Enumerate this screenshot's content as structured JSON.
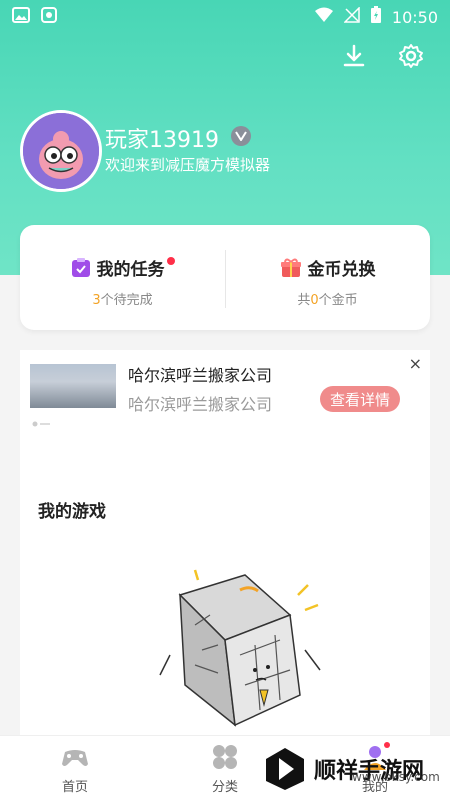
{
  "status_bar": {
    "time": "10:50"
  },
  "header": {
    "download_icon": "download-icon",
    "settings_icon": "gear-icon"
  },
  "profile": {
    "username": "玩家13919",
    "welcome": "欢迎来到减压魔方模拟器"
  },
  "tasks": {
    "title": "我的任务",
    "pending_count": "3",
    "pending_suffix": "个待完成"
  },
  "coins": {
    "title": "金币兑换",
    "prefix": "共",
    "count": "0",
    "suffix": "个金币"
  },
  "ad": {
    "title": "哈尔滨呼兰搬家公司",
    "subtitle": "哈尔滨呼兰搬家公司",
    "cta": "查看详情",
    "close": "×"
  },
  "games": {
    "heading": "我的游戏"
  },
  "tabbar": {
    "tabs": [
      {
        "label": "首页",
        "icon": "gamepad-icon"
      },
      {
        "label": "分类",
        "icon": "grid-icon"
      },
      {
        "label": "我的",
        "icon": "user-icon"
      }
    ]
  },
  "watermark": {
    "brand": "顺祥手游网",
    "url": "www.bksy.com"
  },
  "colors": {
    "accent": "#48d6b5",
    "highlight": "#f3a326",
    "cta": "#f08b8b",
    "badge": "#ff2f49"
  }
}
